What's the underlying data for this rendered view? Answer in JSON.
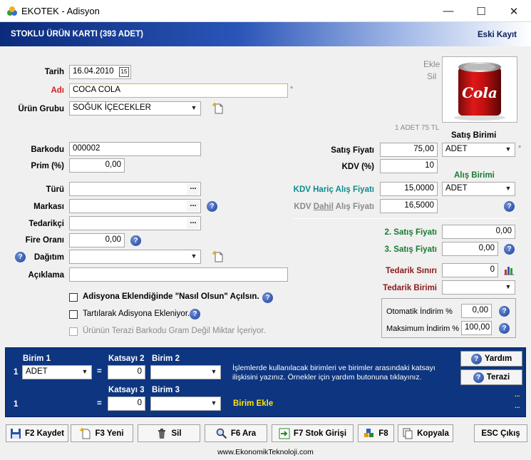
{
  "window": {
    "title": "EKOTEK - Adisyon",
    "minimize_glyph": "—",
    "maximize_glyph": "☐",
    "close_glyph": "✕"
  },
  "header": {
    "title": "STOKLU ÜRÜN KARTI (393 ADET)",
    "eski_kayit": "Eski Kayıt"
  },
  "form": {
    "tarih_label": "Tarih",
    "tarih_value": "16.04.2010",
    "adi_label": "Adı",
    "adi_value": "COCA COLA",
    "urun_grubu_label": "Ürün Grubu",
    "urun_grubu_value": "SOĞUK İÇECEKLER",
    "barkodu_label": "Barkodu",
    "barkodu_value": "000002",
    "prim_label": "Prim (%)",
    "prim_value": "0,00",
    "turu_label": "Türü",
    "markasi_label": "Markası",
    "tedarikci_label": "Tedarikçi",
    "fire_label": "Fire Oranı",
    "fire_value": "0,00",
    "dagitim_label": "Dağıtım",
    "aciklama_label": "Açıklama",
    "required_mark": "*",
    "dots": "..."
  },
  "photo": {
    "ekle": "Ekle",
    "sil": "Sil",
    "can_text": "Cola",
    "caption": "1 ADET 75 TL"
  },
  "pricing": {
    "satis_birimi_label": "Satış Birimi",
    "satis_fiyati_label": "Satış Fiyatı",
    "satis_fiyati_value": "75,00",
    "satis_birimi_value": "ADET",
    "kdv_label": "KDV  (%)",
    "kdv_value": "10",
    "alis_birimi_label": "Alış Birimi",
    "kdv_haric_label": "KDV Hariç Alış Fiyatı",
    "kdv_haric_value": "15,0000",
    "alis_birimi_value": "ADET",
    "kdv_dahil_pre": "KDV ",
    "kdv_dahil_u": "Dahil",
    "kdv_dahil_post": " Alış Fiyatı",
    "kdv_dahil_value": "16,5000",
    "satis2_label": "2. Satış Fiyatı",
    "satis2_value": "0,00",
    "satis3_label": "3. Satış Fiyatı",
    "satis3_value": "0,00",
    "tedarik_siniri_label": "Tedarik Sınırı",
    "tedarik_siniri_value": "0",
    "tedarik_birimi_label": "Tedarik Birimi",
    "otomatik_label": "Otomatik İndirim %",
    "otomatik_value": "0,00",
    "maksimum_label": "Maksimum İndirim %",
    "maksimum_value": "100,00"
  },
  "checkboxes": {
    "nasil_olsun": "Adisyona Eklendiğinde \"Nasıl Olsun\" Açılsın.",
    "tartilarak": "Tartılarak Adisyona Ekleniyor.",
    "terazi_barkodu": "Ürünün Terazi Barkodu Gram Değil Miktar İçeriyor."
  },
  "units": {
    "birim1_label": "Birim 1",
    "katsayi2_label": "Katsayı 2",
    "birim2_label": "Birim 2",
    "katsayi3_label": "Katsayı 3",
    "birim3_label": "Birim 3",
    "row1_num": "1",
    "row2_num": "1",
    "eq": "=",
    "birim1_value": "ADET",
    "katsayi2_value": "0",
    "katsayi3_value": "0",
    "info_text": "İşlemlerde kullanılacak birimleri ve birimler arasındaki katsayı ilişkisini yazınız. Örnekler için yardım butonuna tıklayınız.",
    "birim_ekle": "Birim Ekle",
    "yardim": "Yardım",
    "terazi": "Terazi",
    "ellipsis1": "...",
    "ellipsis2": "..."
  },
  "buttons": {
    "kaydet": "F2 Kaydet",
    "yeni": "F3 Yeni",
    "sil": "Sil",
    "ara": "F6 Ara",
    "stok_girisi": "F7 Stok Girişi",
    "f8": "F8",
    "kopyala": "Kopyala",
    "esc": "ESC Çıkış"
  },
  "footer": {
    "url": "www.EkonomikTeknoloji.com"
  },
  "colors": {
    "accent_blue": "#0d3580",
    "label_red": "#d42020",
    "label_green": "#1a7a30",
    "label_teal": "#0e8b8b",
    "label_maroon": "#8b1a1a"
  }
}
